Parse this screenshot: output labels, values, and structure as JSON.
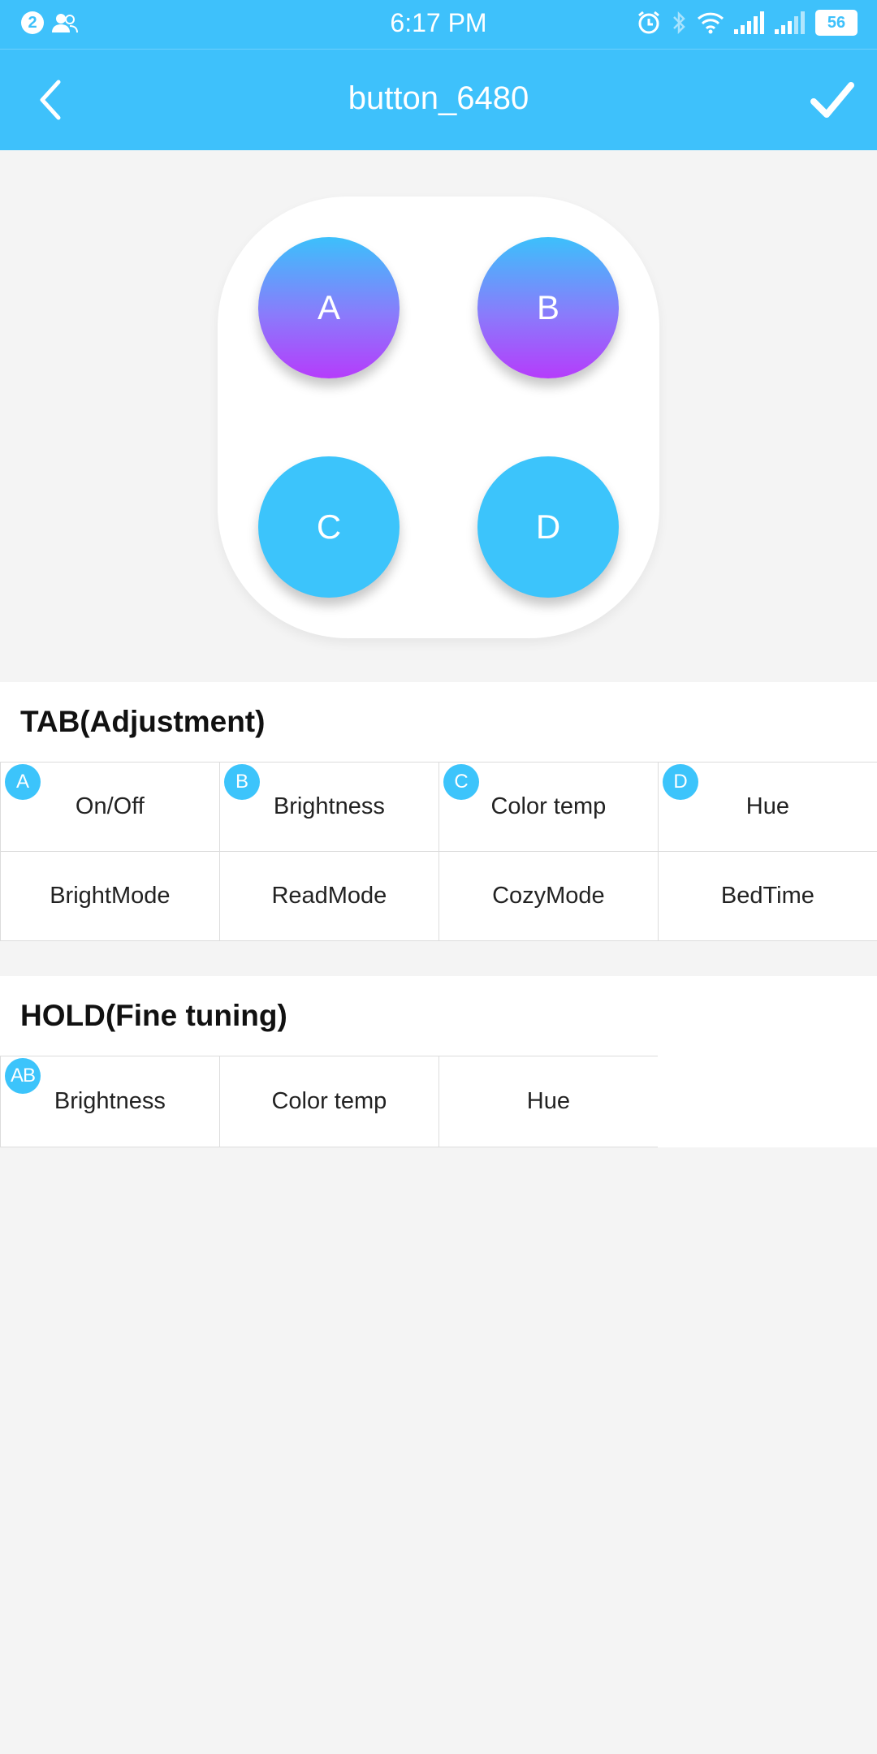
{
  "status_bar": {
    "notification_count": "2",
    "time": "6:17 PM",
    "battery": "56",
    "icons": [
      "contacts-icon",
      "alarm-icon",
      "bluetooth-icon",
      "wifi-icon",
      "signal-icon",
      "signal-2-icon"
    ]
  },
  "header": {
    "title": "button_6480",
    "back_icon": "chevron-left-icon",
    "confirm_icon": "check-icon",
    "background": "#3ec1fb"
  },
  "pad": {
    "buttons": [
      {
        "label": "A",
        "style": "gradient"
      },
      {
        "label": "B",
        "style": "gradient"
      },
      {
        "label": "C",
        "style": "solid"
      },
      {
        "label": "D",
        "style": "solid"
      }
    ]
  },
  "tab_section": {
    "title": "TAB(Adjustment)",
    "rows": [
      [
        {
          "badge": "A",
          "label": "On/Off"
        },
        {
          "badge": "B",
          "label": "Brightness"
        },
        {
          "badge": "C",
          "label": "Color temp"
        },
        {
          "badge": "D",
          "label": "Hue"
        }
      ],
      [
        {
          "badge": "",
          "label": "BrightMode"
        },
        {
          "badge": "",
          "label": "ReadMode"
        },
        {
          "badge": "",
          "label": "CozyMode"
        },
        {
          "badge": "",
          "label": "BedTime"
        }
      ]
    ]
  },
  "hold_section": {
    "title": "HOLD(Fine tuning)",
    "rows": [
      [
        {
          "badge": "AB",
          "label": "Brightness"
        },
        {
          "badge": "",
          "label": "Color temp"
        },
        {
          "badge": "",
          "label": "Hue"
        }
      ]
    ]
  },
  "colors": {
    "accent": "#3ec1fb",
    "gradient_end": "#b53cfb",
    "page_background": "#f4f4f4"
  }
}
